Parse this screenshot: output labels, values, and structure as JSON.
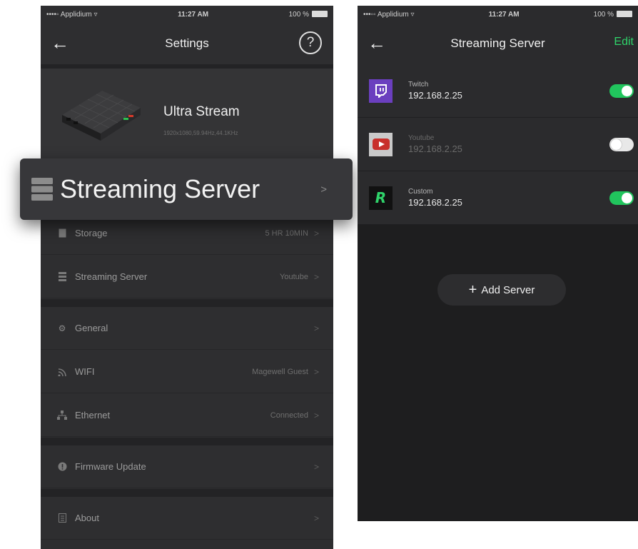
{
  "left_screen": {
    "status": {
      "carrier": "••••◦ Applidium ▿",
      "time": "11:27 AM",
      "battery": "100 %"
    },
    "nav": {
      "title": "Settings"
    },
    "device": {
      "name": "Ultra Stream",
      "spec": "1920x1080,59.94Hz,44.1KHz"
    },
    "highlight": {
      "label": "Streaming Server",
      "chevron": ">"
    },
    "rows": [
      {
        "label": "Storage",
        "value": "5 HR 10MIN",
        "icon": "storage-icon"
      },
      {
        "label": "Streaming Server",
        "value": "Youtube",
        "icon": "server-icon"
      },
      {
        "label": "General",
        "value": "",
        "icon": "gear-icon"
      },
      {
        "label": "WIFI",
        "value": "Magewell Guest",
        "icon": "wifi-icon"
      },
      {
        "label": "Ethernet",
        "value": "Connected",
        "icon": "ethernet-icon"
      },
      {
        "label": "Firmware Update",
        "value": "",
        "icon": "update-icon"
      },
      {
        "label": "About",
        "value": "",
        "icon": "about-icon"
      }
    ],
    "chevron": ">"
  },
  "right_screen": {
    "status": {
      "carrier": "•••◦◦ Applidium ▿",
      "time": "11:27 AM",
      "battery": "100 %"
    },
    "nav": {
      "title": "Streaming Server",
      "edit_label": "Edit"
    },
    "servers": [
      {
        "name": "Twitch",
        "ip": "192.168.2.25",
        "enabled": true,
        "icon": "twitch-icon"
      },
      {
        "name": "Youtube",
        "ip": "192.168.2.25",
        "enabled": false,
        "icon": "youtube-icon"
      },
      {
        "name": "Custom",
        "ip": "192.168.2.25",
        "enabled": true,
        "icon": "custom-r-icon"
      }
    ],
    "add_server_label": "Add Server",
    "add_server_plus": "+"
  },
  "colors": {
    "accent_green": "#21c55d",
    "twitch_purple": "#6b3fbf",
    "youtube_red": "#c8302b"
  }
}
